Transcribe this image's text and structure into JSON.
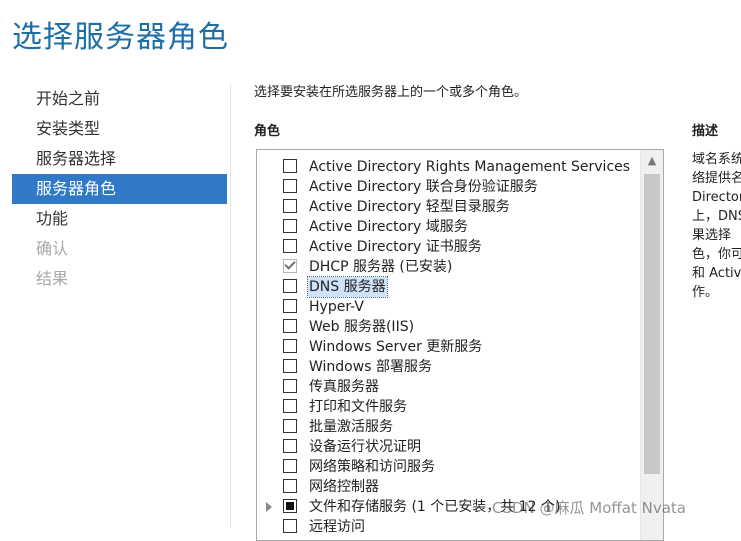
{
  "page_title": "选择服务器角色",
  "nav": [
    {
      "label": "开始之前",
      "state": "normal"
    },
    {
      "label": "安装类型",
      "state": "normal"
    },
    {
      "label": "服务器选择",
      "state": "normal"
    },
    {
      "label": "服务器角色",
      "state": "active"
    },
    {
      "label": "功能",
      "state": "normal"
    },
    {
      "label": "确认",
      "state": "disabled"
    },
    {
      "label": "结果",
      "state": "disabled"
    }
  ],
  "instruction": "选择要安装在所选服务器上的一个或多个角色。",
  "roles_header": "角色",
  "description_header": "描述",
  "roles": [
    {
      "label": "Active Directory Rights Management Services",
      "checked": false
    },
    {
      "label": "Active Directory 联合身份验证服务",
      "checked": false
    },
    {
      "label": "Active Directory 轻型目录服务",
      "checked": false
    },
    {
      "label": "Active Directory 域服务",
      "checked": false
    },
    {
      "label": "Active Directory 证书服务",
      "checked": false
    },
    {
      "label": "DHCP 服务器 (已安装)",
      "checked": true,
      "installed": true
    },
    {
      "label": "DNS 服务器",
      "checked": false,
      "selected": true
    },
    {
      "label": "Hyper-V",
      "checked": false
    },
    {
      "label": "Web 服务器(IIS)",
      "checked": false
    },
    {
      "label": "Windows Server 更新服务",
      "checked": false
    },
    {
      "label": "Windows 部署服务",
      "checked": false
    },
    {
      "label": "传真服务器",
      "checked": false
    },
    {
      "label": "打印和文件服务",
      "checked": false
    },
    {
      "label": "批量激活服务",
      "checked": false
    },
    {
      "label": "设备运行状况证明",
      "checked": false
    },
    {
      "label": "网络策略和访问服务",
      "checked": false
    },
    {
      "label": "网络控制器",
      "checked": false
    },
    {
      "label": "文件和存储服务 (1 个已安装，共 12 个)",
      "checked": "partial",
      "expandable": true
    },
    {
      "label": "远程访问",
      "checked": false
    }
  ],
  "description_lines": [
    "域名系统",
    "络提供名",
    "Directory",
    "上，DNS",
    "果选择",
    "色，你可",
    "和 Active",
    "作。"
  ],
  "watermark": "CSDN @麻瓜 Moffat Nvata"
}
